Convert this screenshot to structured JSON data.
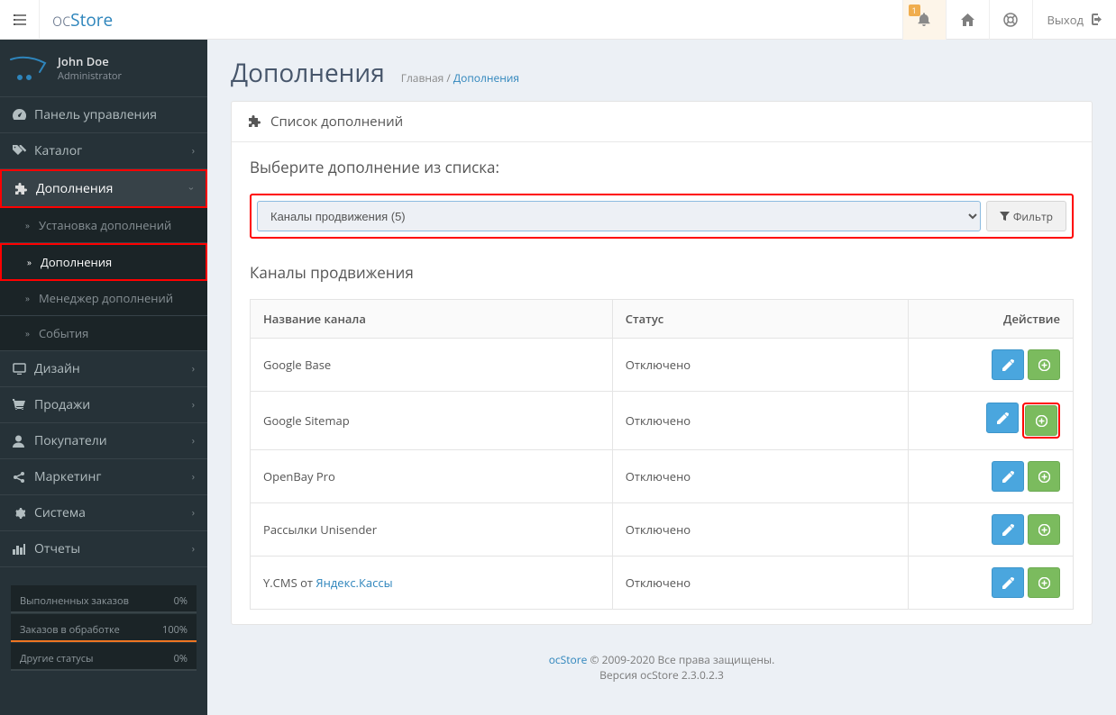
{
  "brand": {
    "oc": "oc",
    "store": "Store"
  },
  "header": {
    "notif_count": "1",
    "logout": "Выход"
  },
  "user": {
    "name": "John Doe",
    "role": "Administrator"
  },
  "sidebar": {
    "dashboard": "Панель управления",
    "catalog": "Каталог",
    "extensions": "Дополнения",
    "ext_install": "Установка дополнений",
    "ext_list": "Дополнения",
    "ext_manager": "Менеджер дополнений",
    "ext_events": "События",
    "design": "Дизайн",
    "sales": "Продажи",
    "customers": "Покупатели",
    "marketing": "Маркетинг",
    "system": "Система",
    "reports": "Отчеты"
  },
  "stats": {
    "done_label": "Выполненных заказов",
    "done_val": "0%",
    "proc_label": "Заказов в обработке",
    "proc_val": "100%",
    "other_label": "Другие статусы",
    "other_val": "0%"
  },
  "page": {
    "title": "Дополнения",
    "bc_home": "Главная",
    "bc_sep": " / ",
    "bc_current": "Дополнения",
    "panel_title": "Список дополнений",
    "choose_title": "Выберите дополнение из списка:",
    "select_value": "Каналы продвижения (5)",
    "filter_btn": "Фильтр",
    "table_title": "Каналы продвижения",
    "col_name": "Название канала",
    "col_status": "Статус",
    "col_action": "Действие",
    "rows": [
      {
        "name": "Google Base",
        "status": "Отключено",
        "link": false
      },
      {
        "name": "Google Sitemap",
        "status": "Отключено",
        "link": false,
        "highlight": true
      },
      {
        "name": "OpenBay Pro",
        "status": "Отключено",
        "link": false
      },
      {
        "name": "Рассылки Unisender",
        "status": "Отключено",
        "link": false
      },
      {
        "name_prefix": "Y.CMS от ",
        "name": "Яндекс.Кассы",
        "status": "Отключено",
        "link": true
      }
    ]
  },
  "footer": {
    "brand": "ocStore",
    "copy": " © 2009-2020 Все права защищены.",
    "version": "Версия ocStore 2.3.0.2.3"
  }
}
